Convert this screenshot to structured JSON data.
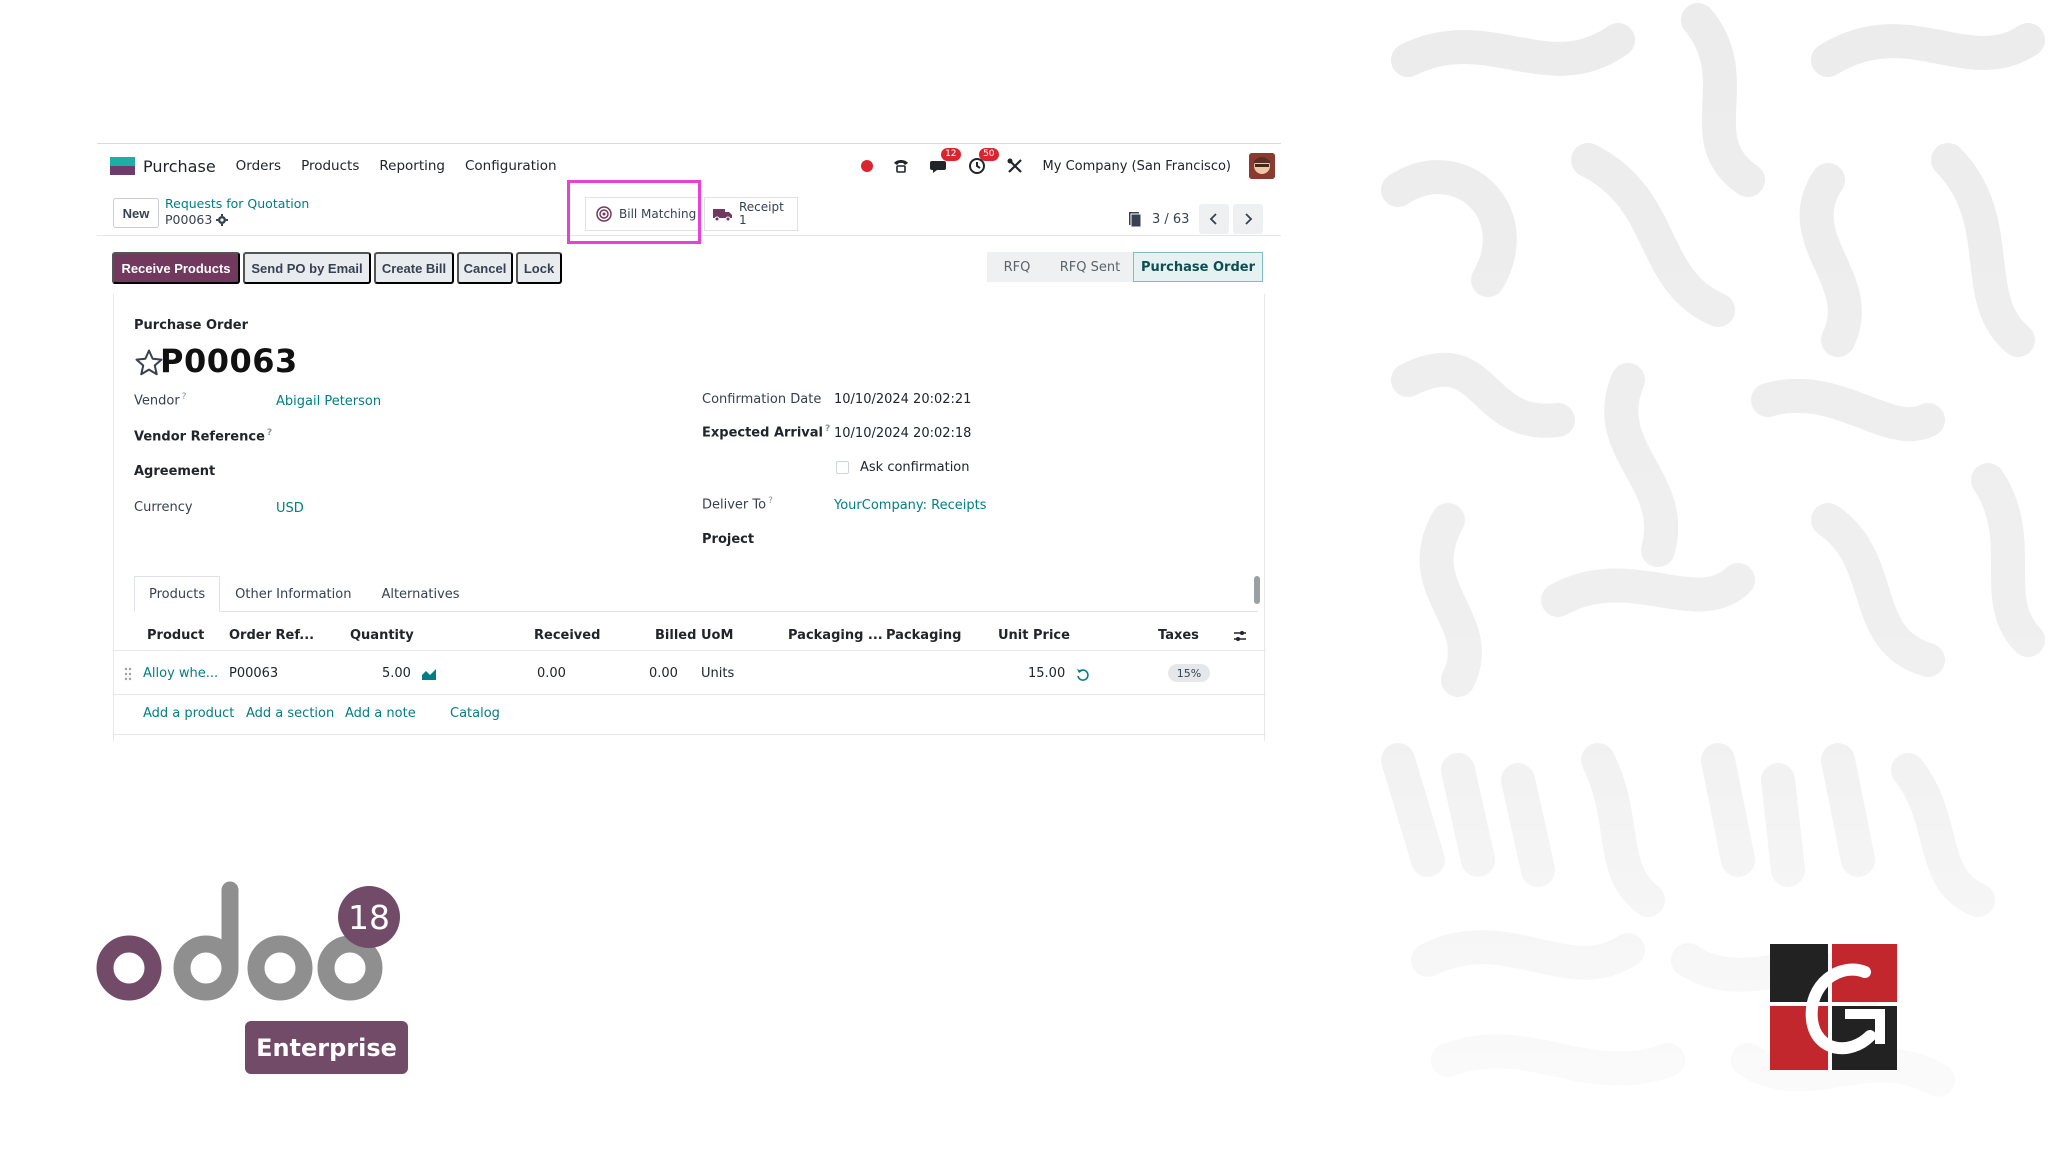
{
  "navbar": {
    "app_name": "Purchase",
    "menu": [
      "Orders",
      "Products",
      "Reporting",
      "Configuration"
    ],
    "messages_badge": "12",
    "activities_badge": "50",
    "company": "My Company (San Francisco)"
  },
  "control": {
    "new_label": "New",
    "breadcrumb_parent": "Requests for Quotation",
    "breadcrumb_current": "P00063",
    "bill_matching_label": "Bill Matching",
    "receipt_label": "Receipt",
    "receipt_count": "1",
    "pager_text": "3 / 63"
  },
  "actions": {
    "receive_products": "Receive Products",
    "send_po": "Send PO by Email",
    "create_bill": "Create Bill",
    "cancel": "Cancel",
    "lock": "Lock"
  },
  "statusbar": {
    "stages": [
      "RFQ",
      "RFQ Sent",
      "Purchase Order"
    ],
    "active": "Purchase Order"
  },
  "form": {
    "record_type": "Purchase Order",
    "name": "P00063",
    "vendor_label": "Vendor",
    "vendor_value": "Abigail Peterson",
    "vendor_ref_label": "Vendor Reference",
    "agreement_label": "Agreement",
    "currency_label": "Currency",
    "currency_value": "USD",
    "confirmation_label": "Confirmation Date",
    "confirmation_value": "10/10/2024 20:02:21",
    "expected_label": "Expected Arrival",
    "expected_value": "10/10/2024 20:02:18",
    "ask_confirmation": "Ask confirmation",
    "deliver_label": "Deliver To",
    "deliver_value": "YourCompany: Receipts",
    "project_label": "Project",
    "help_mark": "?"
  },
  "tabs": [
    "Products",
    "Other Information",
    "Alternatives"
  ],
  "table": {
    "headers": [
      "Product",
      "Order Ref...",
      "Quantity",
      "Received",
      "Billed",
      "UoM",
      "Packaging ...",
      "Packaging",
      "Unit Price",
      "Taxes"
    ],
    "rows": [
      {
        "product": "Alloy whe...",
        "order_ref": "P00063",
        "quantity": "5.00",
        "received": "0.00",
        "billed": "0.00",
        "uom": "Units",
        "unit_price": "15.00",
        "taxes": "15%"
      }
    ],
    "add_links": [
      "Add a product",
      "Add a section",
      "Add a note",
      "Catalog"
    ]
  },
  "branding": {
    "odoo_wordmark": "odoo",
    "version": "18",
    "edition": "Enterprise"
  },
  "colors": {
    "primary": "#71395e",
    "link": "#017e84",
    "highlight": "#e940d6",
    "danger": "#d9262e"
  }
}
